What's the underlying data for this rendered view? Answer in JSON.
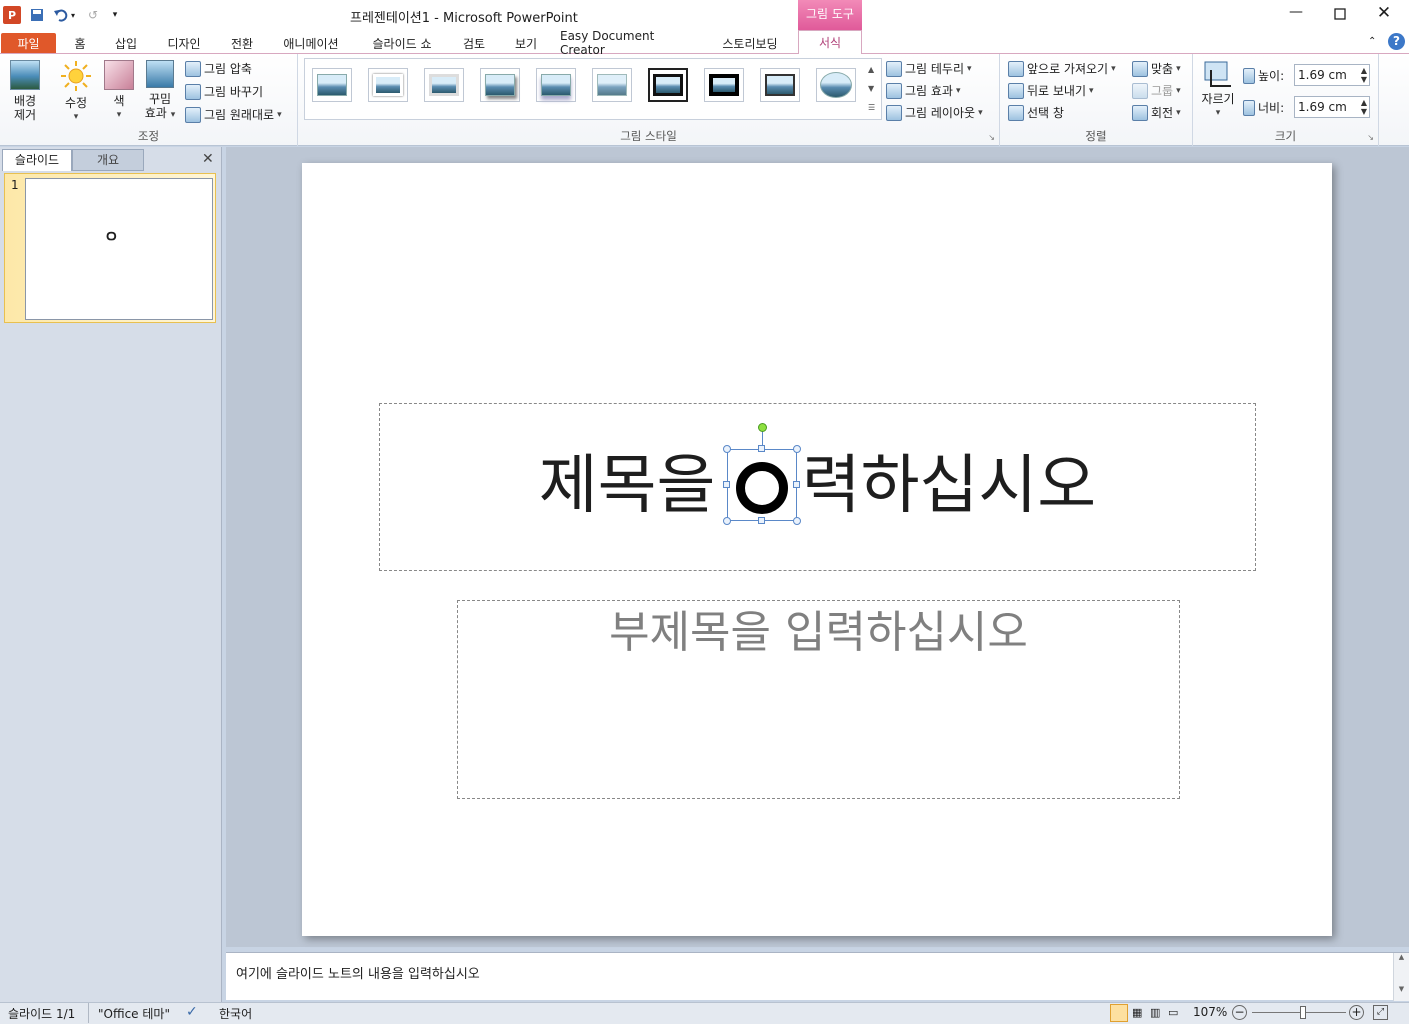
{
  "app": {
    "window_title": "프레젠테이션1  -  Microsoft PowerPoint",
    "context_tab": "그림 도구"
  },
  "tabs": [
    "파일",
    "홈",
    "삽입",
    "디자인",
    "전환",
    "애니메이션",
    "슬라이드 쇼",
    "검토",
    "보기",
    "Easy Document Creator",
    "스토리보딩",
    "서식"
  ],
  "ribbon": {
    "adjust": {
      "remove_bg": [
        "배경",
        "제거"
      ],
      "corrections": "수정",
      "color": "색",
      "artistic": [
        "꾸밈",
        "효과"
      ],
      "compress": "그림 압축",
      "change": "그림 바꾸기",
      "reset": "그림 원래대로",
      "label": "조정"
    },
    "styles": {
      "border": "그림 테두리",
      "effects": "그림 효과",
      "layout": "그림 레이아웃",
      "label": "그림 스타일"
    },
    "arrange": {
      "bring_forward": "앞으로 가져오기",
      "send_backward": "뒤로 보내기",
      "selection_pane": "선택 창",
      "align": "맞춤",
      "group": "그룹",
      "rotate": "회전",
      "label": "정렬"
    },
    "size": {
      "crop": "자르기",
      "height_label": "높이:",
      "height_value": "1.69 cm",
      "width_label": "너비:",
      "width_value": "1.69 cm",
      "label": "크기"
    }
  },
  "pane": {
    "tab_slides": "슬라이드",
    "tab_outline": "개요",
    "slide_number": "1",
    "thumb_glyph": "ㅇ"
  },
  "slide": {
    "title_before": "제목을 ",
    "title_after": "력하십시오",
    "subtitle": "부제목을 입력하십시오"
  },
  "notes": {
    "placeholder": "여기에 슬라이드 노트의 내용을 입력하십시오"
  },
  "status": {
    "slide_info": "슬라이드 1/1",
    "theme": "\"Office 테마\"",
    "language": "한국어",
    "zoom": "107%",
    "zoom_level": 0.54
  },
  "colors": {
    "file_tab": "#e0582a",
    "context_tab": "#e05a9a",
    "ribbon_line": "#d8a8c0"
  }
}
